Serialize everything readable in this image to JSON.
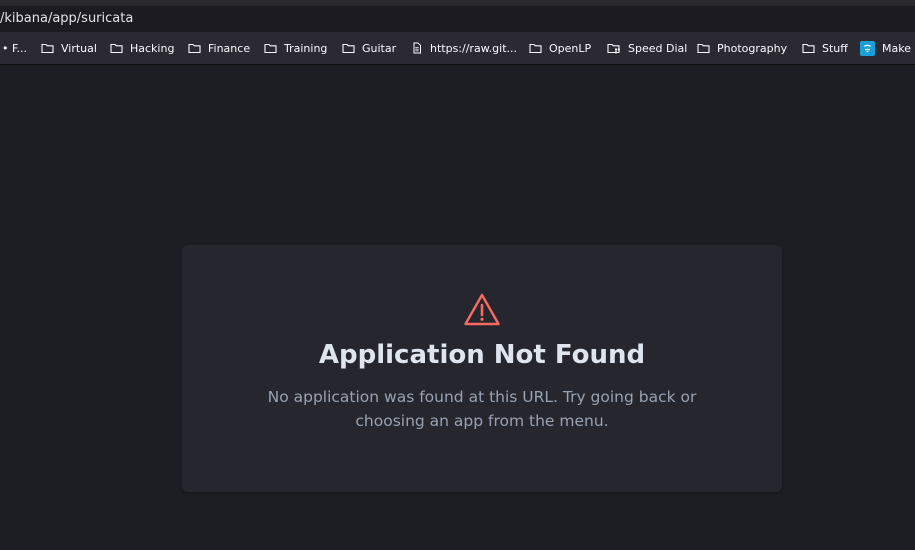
{
  "browser": {
    "url": "/kibana/app/suricata"
  },
  "bookmarks": [
    {
      "label": "• F...",
      "icon": "none"
    },
    {
      "label": "Virtual",
      "icon": "folder-icon"
    },
    {
      "label": "Hacking",
      "icon": "folder-icon"
    },
    {
      "label": "Finance",
      "icon": "folder-icon"
    },
    {
      "label": "Training",
      "icon": "folder-icon"
    },
    {
      "label": "Guitar",
      "icon": "folder-icon"
    },
    {
      "label": "https://raw.git...",
      "icon": "page-icon"
    },
    {
      "label": "OpenLP",
      "icon": "folder-icon"
    },
    {
      "label": "Speed Dial",
      "icon": "speed-dial-folder-icon"
    },
    {
      "label": "Photography",
      "icon": "folder-icon"
    },
    {
      "label": "Stuff",
      "icon": "folder-icon"
    },
    {
      "label": "Make",
      "icon": "app-favicon-icon"
    }
  ],
  "error": {
    "icon": "warning-triangle-icon",
    "icon_color": "#f86b63",
    "title": "Application Not Found",
    "description": "No application was found at this URL. Try going back or choosing an app from the menu."
  }
}
